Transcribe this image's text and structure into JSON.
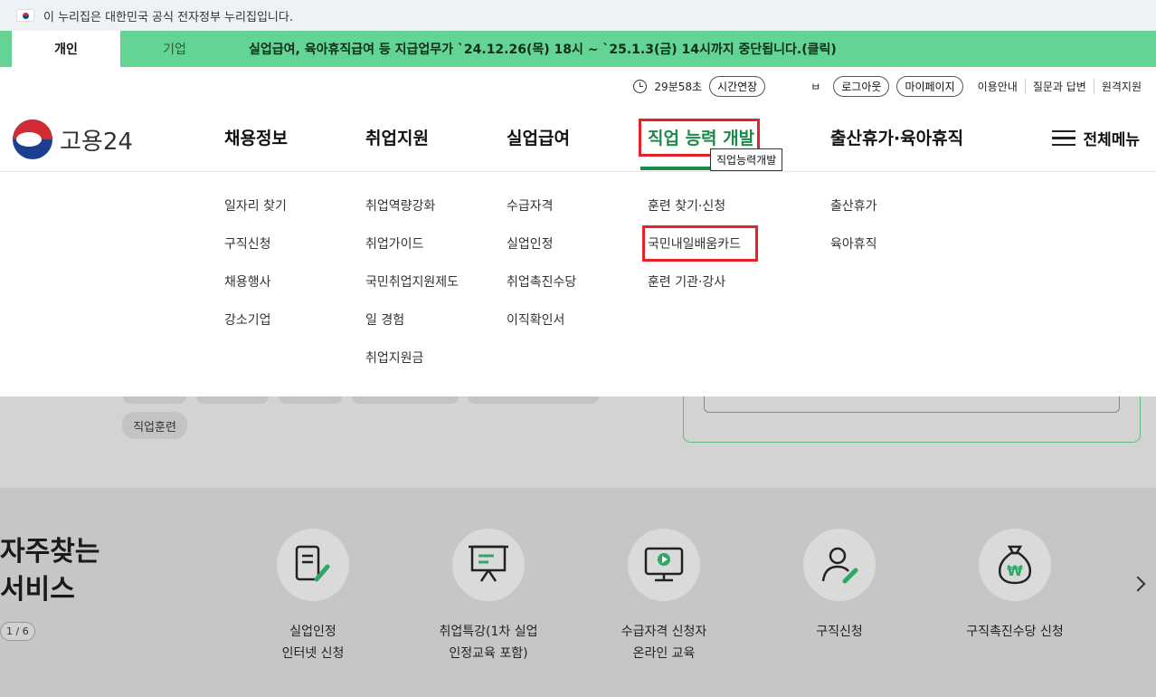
{
  "gov_banner": {
    "text": "이 누리집은 대한민국 공식 전자정부 누리집입니다."
  },
  "user_tabs": [
    {
      "label": "개인"
    },
    {
      "label": "기업"
    }
  ],
  "notice": {
    "text": "실업급여, 육아휴직급여 등 지급업무가 `24.12.26(목) 18시 ~ `25.1.3(금) 14시까지 중단됩니다.(클릭)"
  },
  "util": {
    "timer": "29분58초",
    "extend": "시간연장",
    "user": "ㅂ",
    "logout": "로그아웃",
    "mypage": "마이페이지",
    "links": [
      "이용안내",
      "질문과 답변",
      "원격지원"
    ]
  },
  "logo": {
    "text": "고용24"
  },
  "gnb": [
    {
      "label": "채용정보"
    },
    {
      "label": "취업지원"
    },
    {
      "label": "실업급여"
    },
    {
      "label": "직업 능력 개발"
    },
    {
      "label": "출산휴가·육아휴직"
    }
  ],
  "tooltip": "직업능력개발",
  "all_menu": "전체메뉴",
  "mega": [
    [
      "일자리 찾기",
      "구직신청",
      "채용행사",
      "강소기업"
    ],
    [
      "취업역량강화",
      "취업가이드",
      "국민취업지원제도",
      "일 경험",
      "취업지원금"
    ],
    [
      "수급자격",
      "실업인정",
      "취업촉진수당",
      "이직확인서"
    ],
    [
      "훈련 찾기·신청",
      "국민내일배움카드",
      "훈련 기관·강사"
    ],
    [
      "출산휴가",
      "육아휴직"
    ]
  ],
  "chip": "직업훈련",
  "services": {
    "title1": "자주찾는",
    "title2": "서비스",
    "pager": "1 / 6",
    "items": [
      {
        "line1": "실업인정",
        "line2": "인터넷 신청",
        "icon": "document-pen-icon"
      },
      {
        "line1": "취업특강(1차 실업",
        "line2": "인정교육 포함)",
        "icon": "presentation-board-icon"
      },
      {
        "line1": "수급자격 신청자",
        "line2": "온라인 교육",
        "icon": "video-monitor-icon"
      },
      {
        "line1": "구직신청",
        "line2": "",
        "icon": "person-pen-icon"
      },
      {
        "line1": "구직촉진수당 신청",
        "line2": "",
        "icon": "money-bag-icon"
      }
    ]
  },
  "colors": {
    "brand_green": "#63d493",
    "active_green": "#1b8a4a",
    "highlight_red": "#e8202a"
  }
}
